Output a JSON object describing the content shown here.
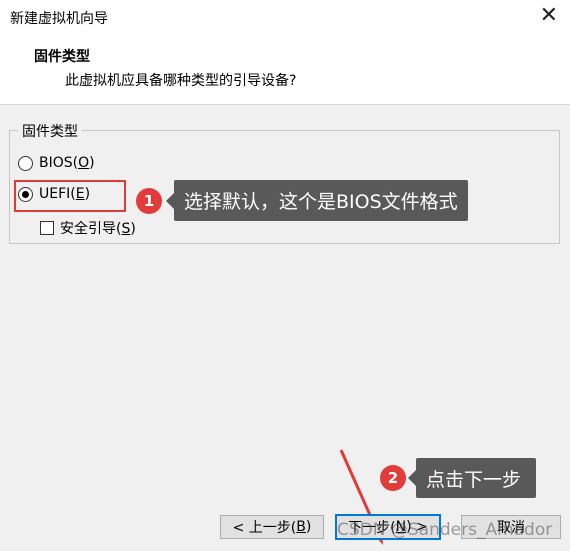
{
  "window": {
    "title": "新建虚拟机向导",
    "close_glyph": "✕"
  },
  "header": {
    "title": "固件类型",
    "subtitle": "此虚拟机应具备哪种类型的引导设备?"
  },
  "firmware_group": {
    "legend": "固件类型",
    "options": [
      {
        "label": "BIOS(",
        "mnemonic": "O",
        "suffix": ")",
        "selected": false
      },
      {
        "label": "UEFI(",
        "mnemonic": "E",
        "suffix": ")",
        "selected": true
      }
    ],
    "secure_boot": {
      "label": "安全引导(",
      "mnemonic": "S",
      "suffix": ")",
      "checked": false
    }
  },
  "annotations": [
    {
      "number": "1",
      "text": "选择默认，这个是BIOS文件格式"
    },
    {
      "number": "2",
      "text": "点击下一步"
    }
  ],
  "buttons": {
    "back": {
      "label": "< 上一步(",
      "mnemonic": "B",
      "suffix": ")"
    },
    "next": {
      "label": "下一步(",
      "mnemonic": "N",
      "suffix": ") >"
    },
    "cancel": {
      "label": "取消"
    }
  },
  "watermark": "CSDN @Sanders_Amador",
  "colors": {
    "highlight": "#e03a3a",
    "callout_bg": "#595959",
    "badge": "#e23b3b"
  }
}
